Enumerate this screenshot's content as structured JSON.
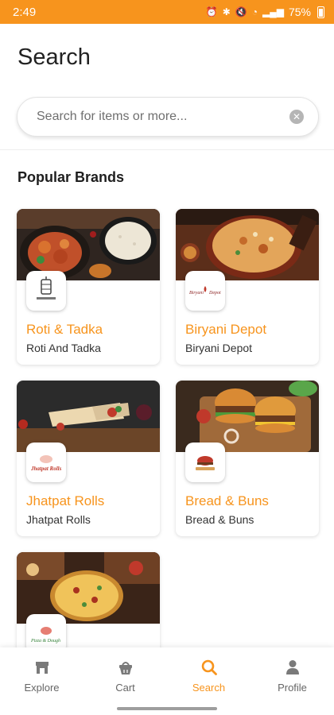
{
  "status_bar": {
    "time": "2:49",
    "battery": "75%"
  },
  "page": {
    "title": "Search"
  },
  "search": {
    "placeholder": "Search for items or more..."
  },
  "section": {
    "title": "Popular Brands"
  },
  "brands": [
    {
      "name": "Roti & Tadka",
      "subtitle": "Roti And Tadka",
      "logo_text": "ROTI & TADKA"
    },
    {
      "name": "Biryani Depot",
      "subtitle": "Biryani Depot",
      "logo_text": "Biryani Depot"
    },
    {
      "name": "Jhatpat Rolls",
      "subtitle": "Jhatpat Rolls",
      "logo_text": "Jhatpat Rolls"
    },
    {
      "name": "Bread & Buns",
      "subtitle": "Bread & Buns",
      "logo_text": "Bread & Buns"
    },
    {
      "name": "",
      "subtitle": "",
      "logo_text": "Pizza & Dough"
    }
  ],
  "nav": {
    "items": [
      {
        "label": "Explore",
        "icon": "explore-icon"
      },
      {
        "label": "Cart",
        "icon": "cart-icon"
      },
      {
        "label": "Search",
        "icon": "search-icon",
        "active": true
      },
      {
        "label": "Profile",
        "icon": "profile-icon"
      }
    ]
  },
  "colors": {
    "accent": "#f7941d",
    "text": "#222222",
    "muted": "#666666"
  }
}
